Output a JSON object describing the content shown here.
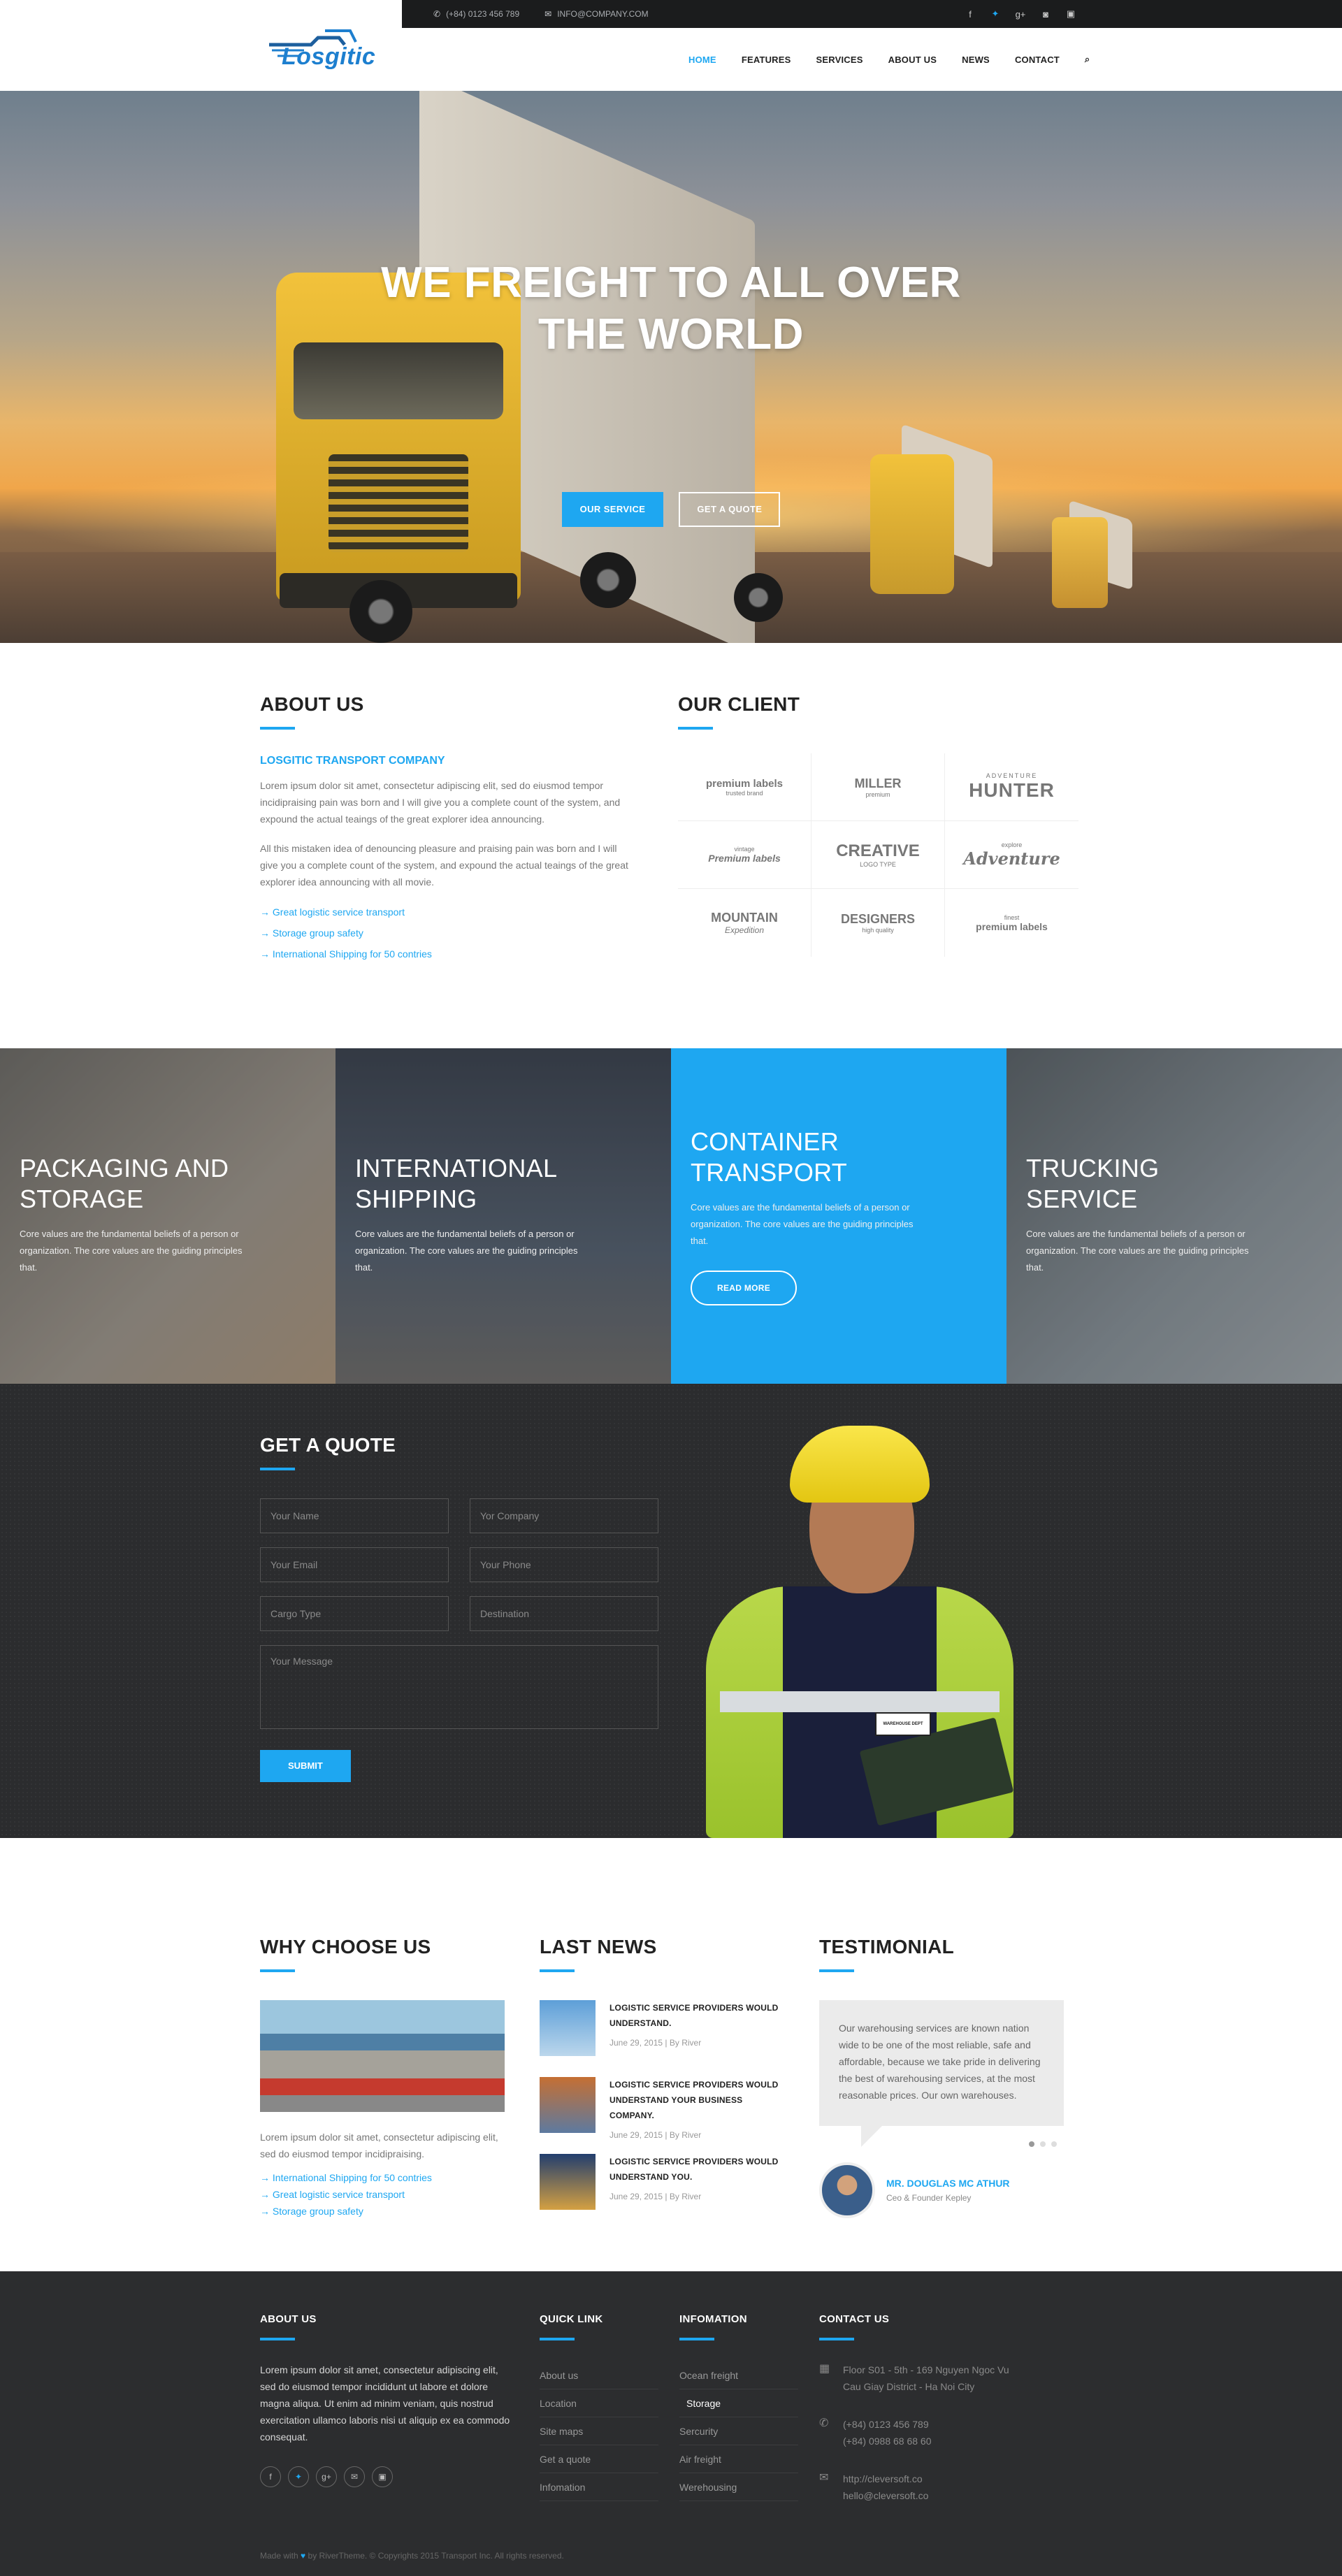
{
  "topbar": {
    "phone": "(+84) 0123 456 789",
    "email": "INFO@COMPANY.COM",
    "social": [
      "facebook-icon",
      "twitter-icon",
      "google-plus-icon",
      "instagram-icon",
      "linkedin-icon"
    ]
  },
  "logo": {
    "text": "Losgitic"
  },
  "nav": {
    "items": [
      "HOME",
      "FEATURES",
      "SERVICES",
      "ABOUT US",
      "NEWS",
      "CONTACT"
    ],
    "active": "HOME",
    "search_icon": "search-icon"
  },
  "hero": {
    "title_line1": "WE FREIGHT TO ALL OVER",
    "title_line2": "THE WORLD",
    "btn_service": "OUR SERVICE",
    "btn_quote": "GET A QUOTE"
  },
  "about": {
    "title": "ABOUT US",
    "subtitle": "LOSGITIC TRANSPORT COMPANY",
    "para1": "Lorem ipsum dolor sit amet, consectetur adipiscing elit, sed do eiusmod tempor incidipraising pain was born and I will give you a complete count of the system, and expound the actual teaings of the great explorer idea announcing.",
    "para2": "All this mistaken idea of denouncing pleasure and praising pain was born and I will give you a complete count of the system, and expound the actual teaings of the great explorer idea announcing with all movie.",
    "links": [
      "→ Great logistic service transport",
      "→ Storage group safety",
      "→ International Shipping for 50 contries"
    ]
  },
  "clients": {
    "title": "OUR CLIENT",
    "logos": [
      [
        "premium labels",
        "trusted brand"
      ],
      [
        "MILLER",
        "premium"
      ],
      [
        "ADVENTURE",
        "HUNTER"
      ],
      [
        "Premium labels",
        "vintage"
      ],
      [
        "CREATIVE",
        "LOGO TYPE"
      ],
      [
        "Adventure",
        "explore"
      ],
      [
        "MOUNTAIN",
        "Expedition"
      ],
      [
        "DESIGNERS",
        "high quality"
      ],
      [
        "premium labels",
        "finest"
      ]
    ]
  },
  "services": [
    {
      "title_l1": "PACKAGING AND",
      "title_l2": "STORAGE",
      "text": "Core values are the fundamental beliefs of a person or organization. The core values are the guiding principles that."
    },
    {
      "title_l1": "INTERNATIONAL",
      "title_l2": "SHIPPING",
      "text": "Core values are the fundamental beliefs of a person or organization. The core values are the guiding principles that."
    },
    {
      "title_l1": "CONTAINER",
      "title_l2": "TRANSPORT",
      "text": "Core values are the fundamental beliefs of a person or organization. The core values are the guiding principles that.",
      "button": "READ MORE"
    },
    {
      "title_l1": "TRUCKING",
      "title_l2": "SERVICE",
      "text": "Core values are the fundamental beliefs of a person or organization. The core values are the guiding principles that."
    }
  ],
  "quote": {
    "title": "GET A QUOTE",
    "fields": {
      "name": "Your Name",
      "company": "Yor Company",
      "email": "Your Email",
      "phone": "Your Phone",
      "cargo": "Cargo Type",
      "destination": "Destination",
      "message": "Your Message"
    },
    "submit": "SUBMIT",
    "badge": "WAREHOUSE DEPT"
  },
  "why": {
    "title": "WHY CHOOSE US",
    "text": "Lorem ipsum dolor sit amet, consectetur adipiscing elit, sed do eiusmod tempor incidipraising.",
    "links": [
      "→ International Shipping for 50 contries",
      "→ Great logistic service transport",
      "→ Storage group safety"
    ]
  },
  "news": {
    "title": "LAST NEWS",
    "items": [
      {
        "headline": "LOGISTIC SERVICE PROVIDERS WOULD UNDERSTAND.",
        "meta": "June 29, 2015  |  By River"
      },
      {
        "headline": "LOGISTIC SERVICE PROVIDERS WOULD UNDERSTAND YOUR BUSINESS COMPANY.",
        "meta": "June 29, 2015  |  By River"
      },
      {
        "headline": "LOGISTIC SERVICE PROVIDERS WOULD UNDERSTAND YOU.",
        "meta": "June 29, 2015  |  By River"
      }
    ]
  },
  "testimonial": {
    "title": "TESTIMONIAL",
    "quote": "Our warehousing services are known nation wide to be one of the most reliable, safe and affordable, because we take pride in delivering the best of warehousing services, at the most reasonable prices. Our own warehouses.",
    "name": "MR. DOUGLAS MC ATHUR",
    "role": "Ceo & Founder Kepley"
  },
  "footer": {
    "about_title": "ABOUT US",
    "about_text": "Lorem ipsum dolor sit amet, consectetur adipiscing elit, sed do eiusmod tempor incididunt ut labore et dolore magna aliqua. Ut enim ad minim veniam, quis nostrud exercitation ullamco laboris nisi ut aliquip ex ea commodo consequat.",
    "quick_title": "QUICK LINK",
    "quick_links": [
      "About us",
      "Location",
      "Site maps",
      "Get a quote",
      "Infomation"
    ],
    "info_title": "INFOMATION",
    "info_links": [
      "Ocean freight",
      "Storage",
      "Sercurity",
      "Air freight",
      "Werehousing"
    ],
    "info_highlight": "Storage",
    "contact_title": "CONTACT US",
    "address": "Floor S01 - 5th - 169 Nguyen Ngoc Vu Cau Giay District - Ha Noi City",
    "phone1": "(+84) 0123 456 789",
    "phone2": "(+84) 0988 68 68 60",
    "web": "http://cleversoft.co",
    "mail": "hello@cleversoft.co",
    "copyright_pre": "Made with",
    "copyright_post": "by RiverTheme. © Copyrights 2015 Transport Inc. All rights reserved."
  },
  "colors": {
    "accent": "#1ea7f1",
    "dark": "#2b2c2e",
    "footer": "#2c2d2f"
  }
}
